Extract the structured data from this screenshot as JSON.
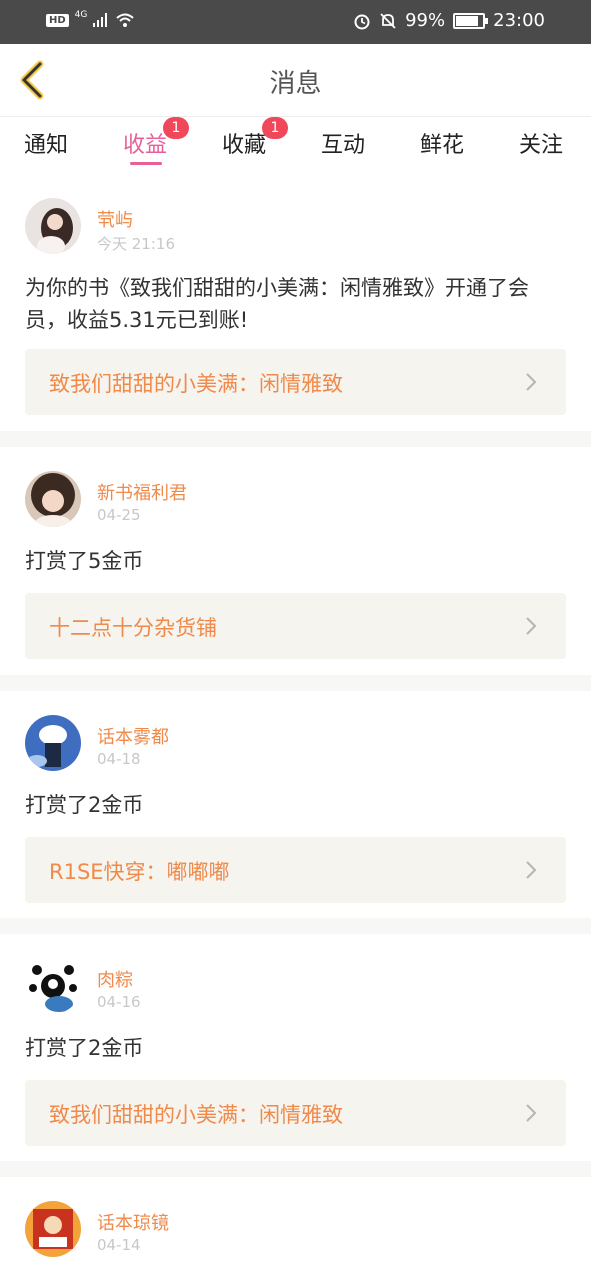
{
  "status_bar": {
    "hd": "HD",
    "network": "4G",
    "battery": "99%",
    "battery_level": 0.99,
    "time": "23:00"
  },
  "header": {
    "title": "消息",
    "back_icon": "chevron-left-icon"
  },
  "tabs": [
    {
      "label": "通知"
    },
    {
      "label": "收益",
      "badge": "1"
    },
    {
      "label": "收藏",
      "badge": "1"
    },
    {
      "label": "互动"
    },
    {
      "label": "鲜花"
    },
    {
      "label": "关注"
    }
  ],
  "messages": [
    {
      "user": "茕屿",
      "time": "今天 21:16",
      "text": "为你的书《致我们甜甜的小美满：闲情雅致》开通了会员，收益5.31元已到账!",
      "book": "致我们甜甜的小美满：闲情雅致"
    },
    {
      "user": "新书福利君",
      "time": "04-25",
      "text": "打赏了5金币",
      "book": "十二点十分杂货铺"
    },
    {
      "user": "话本雾都",
      "time": "04-18",
      "text": "打赏了2金币",
      "book": "R1SE快穿：嘟嘟嘟"
    },
    {
      "user": "肉粽",
      "time": "04-16",
      "text": "打赏了2金币",
      "book": "致我们甜甜的小美满：闲情雅致"
    },
    {
      "user": "话本琼镜",
      "time": "04-14"
    }
  ],
  "colors": {
    "accent": "#e8609a",
    "badge": "#f0475a",
    "username": "#f08a4b",
    "book_bg": "#f5f4ef",
    "status_bar": "#4a4a4a"
  }
}
